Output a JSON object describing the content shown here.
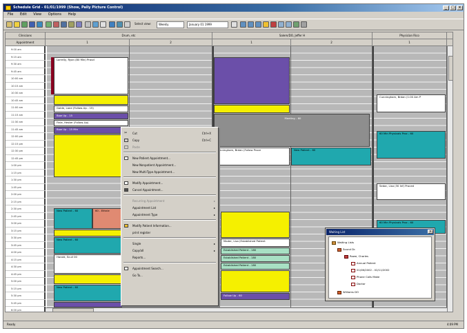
{
  "window": {
    "title": "Schedule Grid - 01/01/1999 (Show, Pally Picture Control)",
    "controls": [
      "_",
      "□",
      "×"
    ]
  },
  "menu": [
    "File",
    "Edit",
    "View",
    "Options",
    "Help"
  ],
  "toolbar": {
    "select_label": "Select view:",
    "view_value": "Weekly",
    "date_value": "January 01 1999"
  },
  "calendar": {
    "corner_top": "Clinicians",
    "corner_bottom": "Appointment",
    "groups": [
      {
        "label": "Drum, etc"
      },
      {
        "label": "Salem/DO, Jeffer H"
      },
      {
        "label": "Physician Rico"
      }
    ],
    "columns": [
      "1",
      "2",
      "1",
      "2",
      "1"
    ],
    "times": [
      "9:00 am",
      "9:15 am",
      "9:30 am",
      "9:45 am",
      "10:00 am",
      "10:15 am",
      "10:30 am",
      "10:45 am",
      "11:00 am",
      "11:15 am",
      "11:30 am",
      "11:45 am",
      "12:00 pm",
      "12:15 pm",
      "12:30 pm",
      "12:45 pm",
      "1:00 pm",
      "1:15 pm",
      "1:30 pm",
      "1:45 pm",
      "2:00 pm",
      "2:15 pm",
      "2:30 pm",
      "2:45 pm",
      "3:00 pm",
      "3:15 pm",
      "3:30 pm",
      "3:45 pm",
      "4:00 pm",
      "4:15 pm",
      "4:30 pm",
      "4:45 pm",
      "5:00 pm",
      "5:15 pm",
      "5:30 pm",
      "5:45 pm",
      "6:00 pm"
    ],
    "appointments": {
      "a1": "Lorrelly, Ryan (80 Min) Pravd",
      "a2": "Golde, Lane (Follow-Up - 15)",
      "a3": "Bow Up - 15",
      "a4": "Finle, Hester (Follow-Up)",
      "a5": "Bow Up - 15 Min",
      "a6": "New Patient - 60",
      "a7": "60 - Ethnie",
      "a8": "New Patient - 60",
      "a9": "Harold, Scull 00",
      "a10": "New Patient - 60",
      "a11": "Meeting - 60",
      "a12": "Cunningham, Brdan (Follow Proce",
      "a13": "New Patient - 60",
      "a14": "Mader, Lisa (Established Patient",
      "a15": "Established Patient - 180",
      "a16": "Established Patient - 180",
      "a17": "Established Patient - 180",
      "a18": "Follow Up - 60",
      "a19": "Cunningham, Brdan (1:00 Am P",
      "a20": "60 Min Physicals Proc - 60",
      "a21": "Sedar, Lisa (30 Inf) Proced",
      "a22": "60 Min Physicals Proc - 60"
    }
  },
  "context_menu": {
    "cut": "Cut",
    "cut_key": "Ctrl+X",
    "copy": "Copy",
    "copy_key": "Ctrl+C",
    "paste": "Paste",
    "new_patient": "New Patient Appointment...",
    "new_nonpatient": "New Nonpatient Appointment...",
    "new_multi": "New Multi-Type Appointment...",
    "modify": "Modify Appointment...",
    "cancel": "Cancel Appointment...",
    "recurring": "Recurring Appointment",
    "appt_list": "Appointment List",
    "appt_type": "Appointment Type",
    "modify_patient": "Modify Patient Information...",
    "print_register": "print register",
    "single": "Single",
    "copy_all": "Copy/all",
    "reports": "Reports...",
    "search": "Appointment Search...",
    "goto": "Go To..."
  },
  "waiting_list": {
    "title": "Waiting List",
    "items": [
      "Waiting Lists",
      "Sound Dr.",
      "Rowe, Charles",
      "Annual Patient",
      "01/06/2002 - 02/11/2002",
      "Phone Calls Make",
      "Doctor",
      "Williams DO"
    ]
  },
  "status": {
    "left": "Ready",
    "right": "4:09 PM"
  },
  "colors": {
    "purple": "#6b4fa9",
    "yellow": "#f5f000",
    "teal": "#20a8ae",
    "salmon": "#e08a72",
    "mint": "#a8e0c4",
    "gray_block": "#8e8e8e",
    "white_appt": "#ffffff",
    "dark_red_bar": "#8a0020"
  }
}
